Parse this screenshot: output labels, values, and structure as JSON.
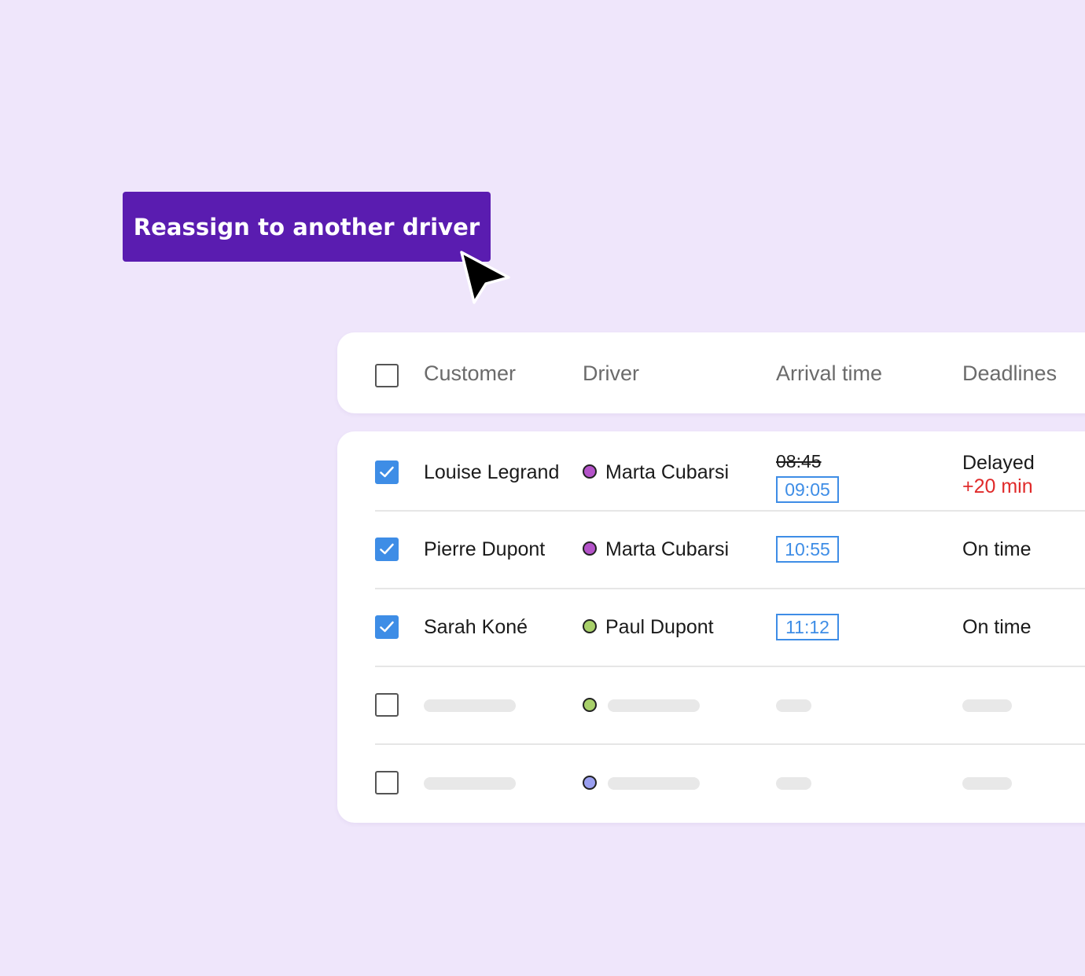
{
  "action": {
    "reassign_label": "Reassign to another driver"
  },
  "table": {
    "headers": {
      "customer": "Customer",
      "driver": "Driver",
      "arrival_time": "Arrival time",
      "deadlines": "Deadlines"
    },
    "rows": [
      {
        "checked": true,
        "customer": "Louise Legrand",
        "driver": "Marta Cubarsi",
        "driver_color": "#b453c9",
        "old_time": "08:45",
        "arrival": "09:05",
        "deadline": "Delayed",
        "delay": "+20 min"
      },
      {
        "checked": true,
        "customer": "Pierre Dupont",
        "driver": "Marta Cubarsi",
        "driver_color": "#b453c9",
        "arrival": "10:55",
        "deadline": "On time"
      },
      {
        "checked": true,
        "customer": "Sarah Koné",
        "driver": "Paul Dupont",
        "driver_color": "#a8d06a",
        "arrival": "11:12",
        "deadline": "On time"
      },
      {
        "checked": false,
        "placeholder": true,
        "driver_color": "#a8d06a"
      },
      {
        "checked": false,
        "placeholder": true,
        "driver_color": "#9a9ff0"
      }
    ]
  },
  "colors": {
    "background": "#efe6fb",
    "primary_button": "#5a1cb0",
    "checkbox_checked": "#3e8de6",
    "time_accent": "#3e8de6",
    "delay_text": "#e02a2a"
  },
  "icons": {
    "cursor": "arrow-cursor-icon",
    "check": "checkmark-icon"
  }
}
